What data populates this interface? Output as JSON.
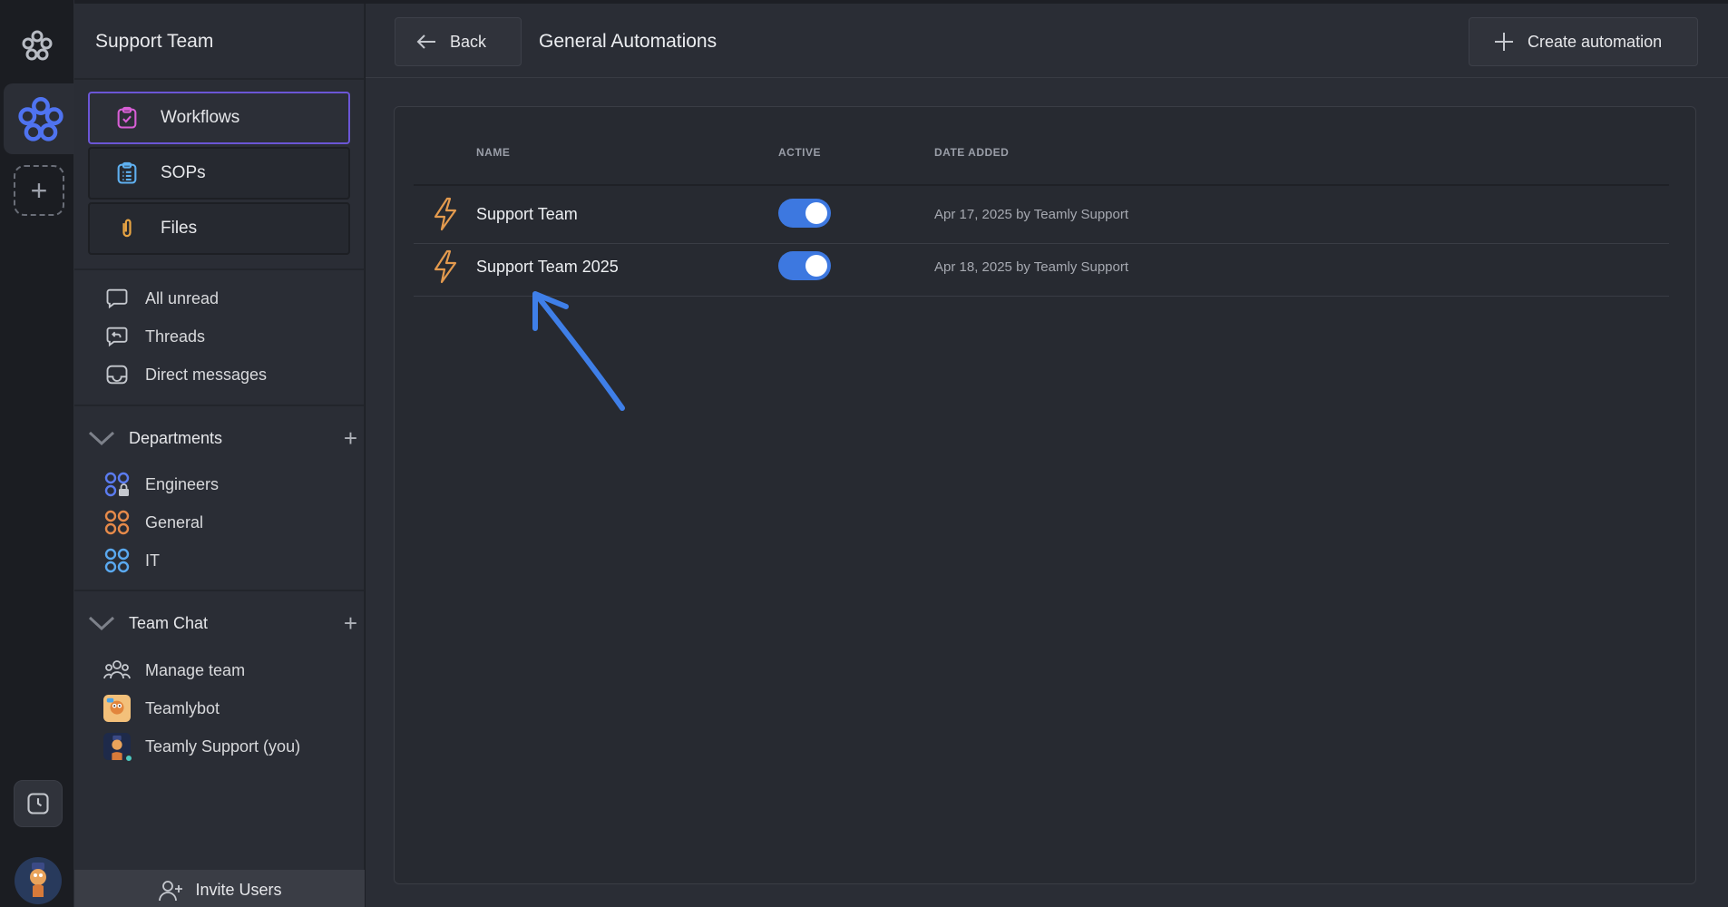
{
  "sidebar": {
    "workspace_title": "Support Team",
    "primary_nav": [
      {
        "label": "Workflows",
        "icon": "clipboard-check-icon",
        "active": true
      },
      {
        "label": "SOPs",
        "icon": "clipboard-list-icon",
        "active": false
      },
      {
        "label": "Files",
        "icon": "paperclip-icon",
        "active": false
      }
    ],
    "quick_links": [
      {
        "label": "All unread",
        "icon": "chat-bubble-icon"
      },
      {
        "label": "Threads",
        "icon": "thread-reply-icon"
      },
      {
        "label": "Direct messages",
        "icon": "inbox-icon"
      }
    ],
    "departments": {
      "title": "Departments",
      "items": [
        {
          "label": "Engineers",
          "icon": "group-locked-icon",
          "color": "#5b7cf0"
        },
        {
          "label": "General",
          "icon": "group-icon",
          "color": "#e68a4a"
        },
        {
          "label": "IT",
          "icon": "group-icon",
          "color": "#5aa9f0"
        }
      ]
    },
    "team_chat": {
      "title": "Team Chat",
      "items": [
        {
          "label": "Manage team",
          "icon": "people-icon"
        },
        {
          "label": "Teamlybot",
          "icon": "bot-avatar"
        },
        {
          "label": "Teamly Support (you)",
          "icon": "user-avatar"
        }
      ]
    },
    "invite_label": "Invite Users"
  },
  "header": {
    "back_label": "Back",
    "title": "General Automations",
    "create_label": "Create automation"
  },
  "table": {
    "columns": [
      "NAME",
      "ACTIVE",
      "DATE ADDED"
    ],
    "rows": [
      {
        "name": "Support Team",
        "active": true,
        "date_added": "Apr 17, 2025 by Teamly Support"
      },
      {
        "name": "Support Team 2025",
        "active": true,
        "date_added": "Apr 18, 2025 by Teamly Support"
      }
    ]
  },
  "colors": {
    "accent": "#3d78e0",
    "workflow_border": "#6b56d6",
    "bolt": "#e39a4e",
    "annotation": "#3f7fe8"
  }
}
